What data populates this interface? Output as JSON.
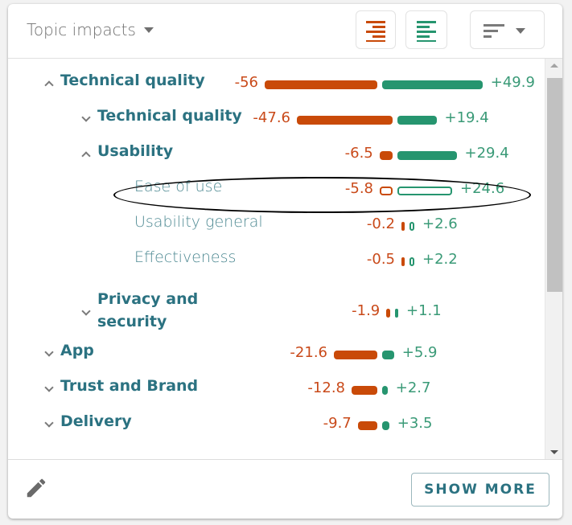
{
  "header": {
    "title": "Topic impacts",
    "title_dropdown_icon": "caret-down-icon",
    "buttons": [
      {
        "name": "sort-by-negative-button",
        "icon": "align-right-lines-icon",
        "color": "#c94a08"
      },
      {
        "name": "sort-by-positive-button",
        "icon": "align-left-lines-icon",
        "color": "#26956f"
      },
      {
        "name": "sort-options-dropdown",
        "icon": "sort-lines-icon",
        "color": "#7a7a7a"
      }
    ]
  },
  "colors": {
    "negative": "#c94a08",
    "positive": "#26956f",
    "label": "#2b7281"
  },
  "topics": [
    {
      "label": "Technical quality",
      "level": 0,
      "expanded": true,
      "negative": -56,
      "positive": 49.9,
      "neg_text": "-56",
      "pos_text": "+49.9"
    },
    {
      "label": "Technical quality",
      "level": 1,
      "expanded": false,
      "negative": -47.6,
      "positive": 19.4,
      "neg_text": "-47.6",
      "pos_text": "+19.4"
    },
    {
      "label": "Usability",
      "level": 1,
      "expanded": true,
      "negative": -6.5,
      "positive": 29.4,
      "neg_text": "-6.5",
      "pos_text": "+29.4"
    },
    {
      "label": "Ease of use",
      "level": 2,
      "leaf": true,
      "highlighted": true,
      "negative": -5.8,
      "positive": 24.6,
      "neg_text": "-5.8",
      "pos_text": "+24.6"
    },
    {
      "label": "Usability general",
      "level": 2,
      "leaf": true,
      "negative": -0.2,
      "positive": 2.6,
      "neg_text": "-0.2",
      "pos_text": "+2.6"
    },
    {
      "label": "Effectiveness",
      "level": 2,
      "leaf": true,
      "negative": -0.5,
      "positive": 2.2,
      "neg_text": "-0.5",
      "pos_text": "+2.2"
    },
    {
      "label": "Privacy and security",
      "label_lines": [
        "Privacy and",
        "security"
      ],
      "level": 1,
      "expanded": false,
      "negative": -1.9,
      "positive": 1.1,
      "neg_text": "-1.9",
      "pos_text": "+1.1"
    },
    {
      "label": "App",
      "level": 0,
      "expanded": false,
      "negative": -21.6,
      "positive": 5.9,
      "neg_text": "-21.6",
      "pos_text": "+5.9"
    },
    {
      "label": "Trust and Brand",
      "level": 0,
      "expanded": false,
      "negative": -12.8,
      "positive": 2.7,
      "neg_text": "-12.8",
      "pos_text": "+2.7"
    },
    {
      "label": "Delivery",
      "level": 0,
      "expanded": false,
      "negative": -9.7,
      "positive": 3.5,
      "neg_text": "-9.7",
      "pos_text": "+3.5"
    }
  ],
  "footer": {
    "edit_icon": "pencil-icon",
    "show_more_label": "SHOW MORE"
  }
}
